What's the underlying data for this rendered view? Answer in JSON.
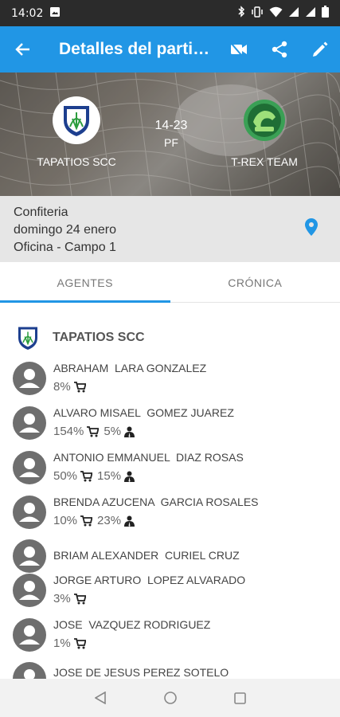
{
  "status_bar": {
    "time": "14:02"
  },
  "app_bar": {
    "title": "Detalles del partido"
  },
  "match": {
    "home_team": "TAPATIOS SCC",
    "away_team": "T-REX TEAM",
    "score": "14-23",
    "status": "PF"
  },
  "venue": {
    "line1": "Confiteria",
    "line2": "domingo 24 enero",
    "line3": "Oficina - Campo 1"
  },
  "tabs": [
    {
      "label": "AGENTES"
    },
    {
      "label": "CRÓNICA"
    }
  ],
  "roster": {
    "team_name": "TAPATIOS SCC",
    "players": [
      {
        "name": "ABRAHAM  LARA GONZALEZ",
        "cart_pct": "8%",
        "person_pct": ""
      },
      {
        "name": "ALVARO MISAEL  GOMEZ JUAREZ",
        "cart_pct": "154%",
        "person_pct": "5%"
      },
      {
        "name": "ANTONIO EMMANUEL  DIAZ ROSAS",
        "cart_pct": "50%",
        "person_pct": "15%"
      },
      {
        "name": "BRENDA AZUCENA  GARCIA ROSALES",
        "cart_pct": "10%",
        "person_pct": "23%"
      },
      {
        "name": "BRIAM ALEXANDER  CURIEL CRUZ",
        "cart_pct": "",
        "person_pct": ""
      },
      {
        "name": "JORGE ARTURO  LOPEZ ALVARADO",
        "cart_pct": "3%",
        "person_pct": ""
      },
      {
        "name": "JOSE  VAZQUEZ RODRIGUEZ",
        "cart_pct": "1%",
        "person_pct": ""
      },
      {
        "name": "JOSE DE JESUS PEREZ SOTELO",
        "cart_pct": "",
        "person_pct": ""
      }
    ]
  },
  "colors": {
    "primary": "#2196e5",
    "status_bar": "#2b2b2b",
    "venue_bg": "#e6e6e6"
  }
}
